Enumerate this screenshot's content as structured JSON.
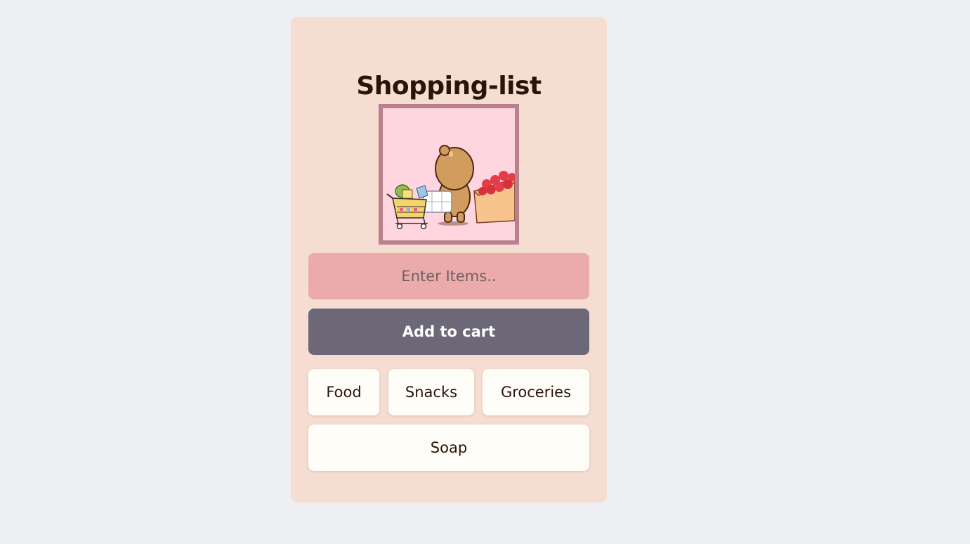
{
  "app": {
    "title": "Shopping-list"
  },
  "image": {
    "icon": "bear-shopping-cart-illustration"
  },
  "input": {
    "placeholder": "Enter Items..",
    "value": ""
  },
  "actions": {
    "add_label": "Add to cart"
  },
  "items": [
    {
      "label": "Food"
    },
    {
      "label": "Snacks"
    },
    {
      "label": "Groceries"
    },
    {
      "label": "Soap"
    }
  ],
  "colors": {
    "page_bg": "#eeeff3",
    "card_bg": "#f6ddd2",
    "input_bg": "#ebabab",
    "button_bg": "#6d6878",
    "chip_bg": "#fffdf8",
    "image_border": "#b9808d"
  }
}
